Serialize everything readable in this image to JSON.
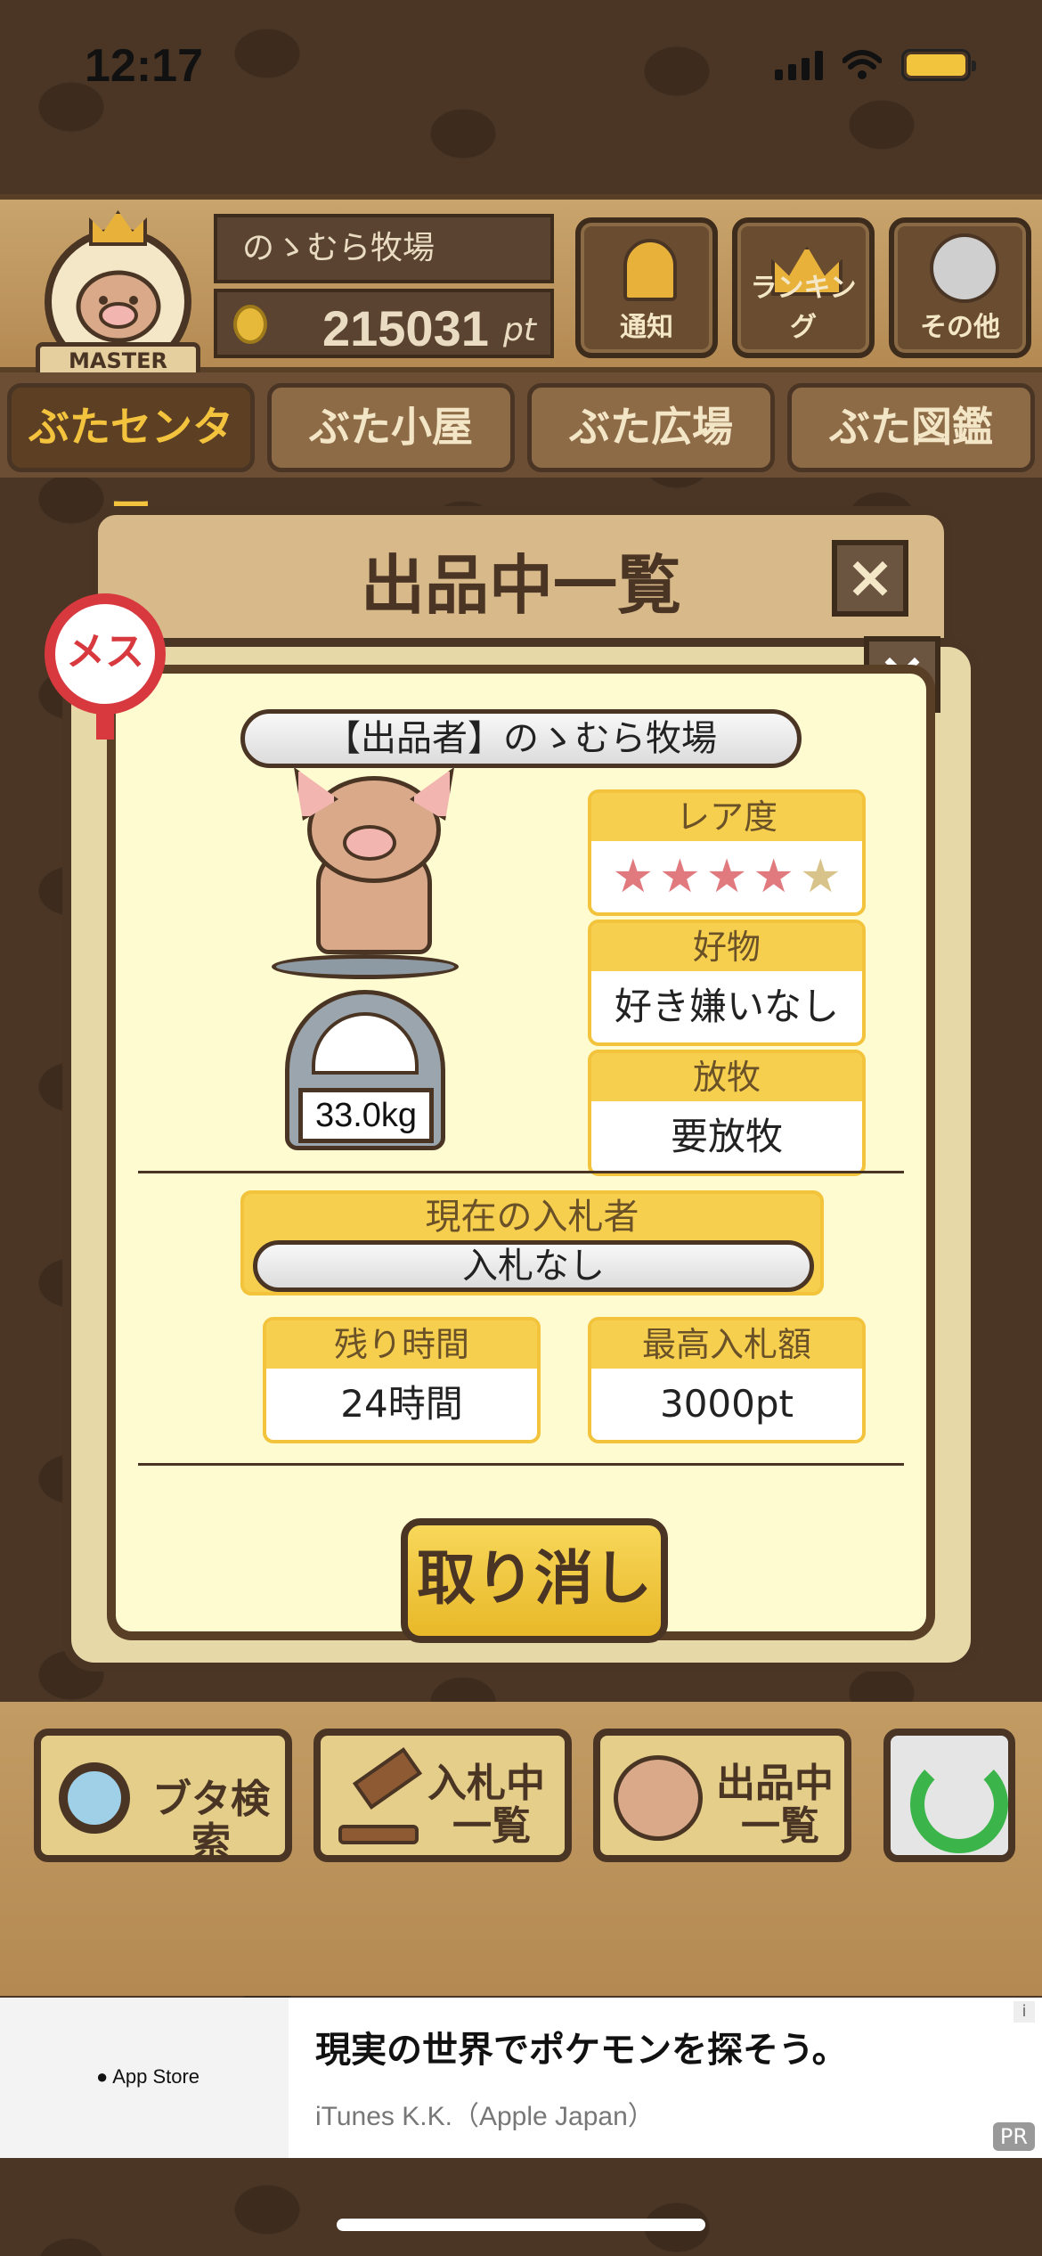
{
  "status_bar": {
    "time": "12:17"
  },
  "header": {
    "badge_text": "MASTER",
    "farm_name": "のゝむら牧場",
    "points_value": "215031",
    "points_unit": "pt",
    "buttons": [
      {
        "label": "通知",
        "icon": "bell-icon"
      },
      {
        "label": "ランキング",
        "icon": "crown-icon"
      },
      {
        "label": "その他",
        "icon": "gear-icon"
      }
    ]
  },
  "tabs": [
    {
      "label": "ぶたセンター",
      "active": true
    },
    {
      "label": "ぶた小屋",
      "active": false
    },
    {
      "label": "ぶた広場",
      "active": false
    },
    {
      "label": "ぶた図鑑",
      "active": false
    }
  ],
  "listing_panel": {
    "title": "出品中一覧",
    "close_label": "×"
  },
  "detail": {
    "gender_label": "メス",
    "close_label": "×",
    "seller": "【出品者】のゝむら牧場",
    "weight": "33.0kg",
    "rarity": {
      "header": "レア度",
      "stars_total": 5,
      "stars_filled": 4
    },
    "favorite": {
      "header": "好物",
      "value": "好き嫌いなし"
    },
    "grazing": {
      "header": "放牧",
      "value": "要放牧"
    },
    "current_bidder": {
      "header": "現在の入札者",
      "value": "入札なし"
    },
    "time_left": {
      "header": "残り時間",
      "value": "24時間"
    },
    "highest_bid": {
      "header": "最高入札額",
      "value": "3000pt"
    },
    "cancel_label": "取り消し"
  },
  "bottom_buttons": {
    "search": "ブタ検索",
    "bidding_line1": "入札中",
    "bidding_line2": "一覧",
    "listing_line1": "出品中",
    "listing_line2": "一覧"
  },
  "ad": {
    "store": "App Store",
    "title": "現実の世界でポケモンを探そう。",
    "subtitle": "iTunes K.K.（Apple Japan）",
    "pr": "PR",
    "info": "i"
  },
  "colors": {
    "accent_yellow": "#f5cf4d",
    "wood_dark": "#4a3524",
    "star_filled": "#e07a7e",
    "star_empty": "#d8c48a",
    "gender_red": "#d8393f"
  }
}
